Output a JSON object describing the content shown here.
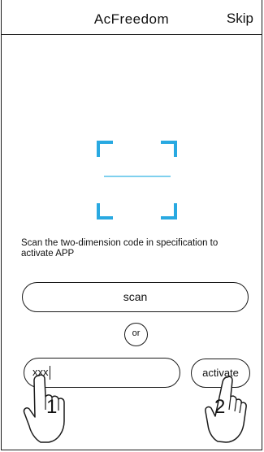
{
  "header": {
    "title": "AcFreedom",
    "skip_label": "Skip"
  },
  "scanner": {
    "accent_color": "#29a9e1",
    "line_color": "#7fd0ee"
  },
  "instruction_text": "Scan the two-dimension code in specification to activate APP",
  "scan_button_label": "scan",
  "or_label": "or",
  "code_input": {
    "value": "xxx"
  },
  "activate_button_label": "activate",
  "steps": {
    "step1": "1",
    "step2": "2"
  },
  "icons": {
    "hand_pointer": "hand-pointer-icon"
  }
}
